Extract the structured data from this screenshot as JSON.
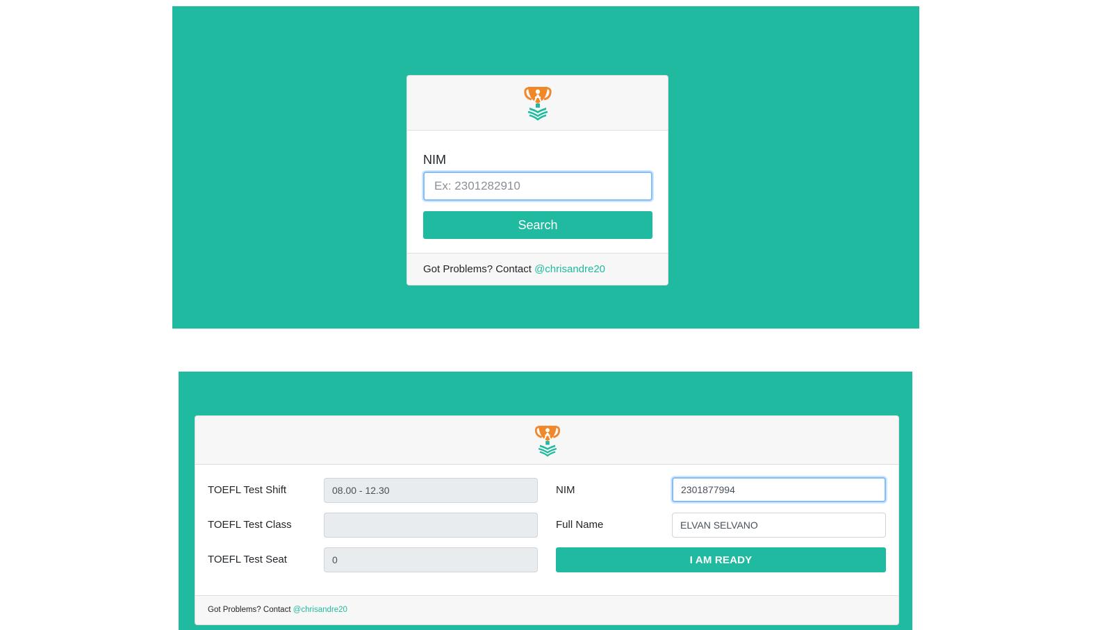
{
  "brand": {
    "accent_color": "#1fba9f",
    "logo_icon": "trophy-book-logo-icon"
  },
  "search_card": {
    "nim_label": "NIM",
    "nim_placeholder": "Ex: 2301282910",
    "search_button_label": "Search",
    "footer_text": "Got Problems? Contact ",
    "footer_link": "@chrisandre20"
  },
  "detail_card": {
    "shift_label": "TOEFL Test Shift",
    "shift_value": "08.00 - 12.30",
    "class_label": "TOEFL Test Class",
    "class_value": "",
    "seat_label": "TOEFL Test Seat",
    "seat_value": "0",
    "nim_label": "NIM",
    "nim_value": "2301877994",
    "fullname_label": "Full Name",
    "fullname_value": "ELVAN SELVANO",
    "ready_button_label": "I AM READY",
    "footer_text": "Got Problems? Contact ",
    "footer_link": "@chrisandre20"
  }
}
